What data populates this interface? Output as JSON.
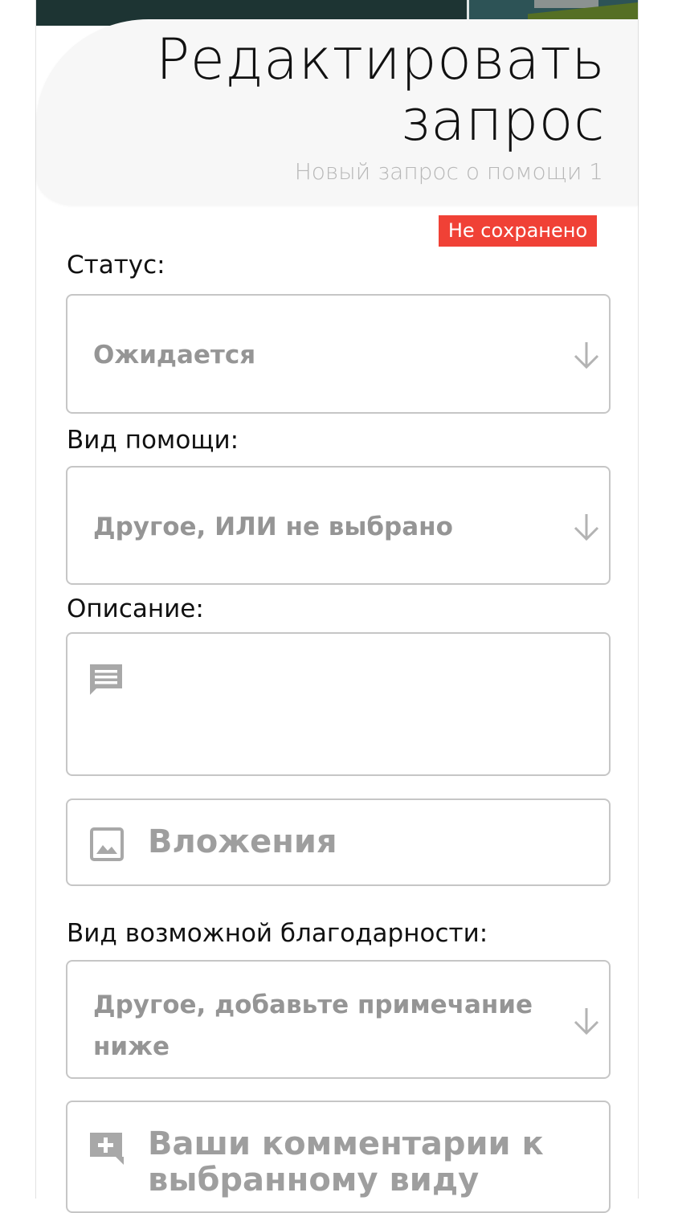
{
  "header": {
    "title": "Редактировать запрос",
    "subtitle": "Новый запрос о помощи 1",
    "status_badge": "Не сохранено"
  },
  "form": {
    "status": {
      "label": "Статус:",
      "value": "Ожидается"
    },
    "help_type": {
      "label": "Вид помощи:",
      "value": "Другое, ИЛИ не выбрано"
    },
    "description": {
      "label": "Описание:",
      "value": ""
    },
    "attachments": {
      "placeholder": "Вложения"
    },
    "gratitude_type": {
      "label": "Вид возможной благодарности:",
      "value": "Другое, добавьте примечание ниже"
    },
    "gratitude_comment": {
      "placeholder": "Ваши комментарии к выбранному виду"
    }
  },
  "icons": {
    "select_arrow": "arrow-down-icon",
    "description": "comment-icon",
    "attachments": "image-icon",
    "comment_add": "add-comment-icon"
  },
  "colors": {
    "badge_bg": "#f04136",
    "badge_text": "#ffffff",
    "header_card_bg": "#f7f7f7",
    "hero_dark": "#1d3433",
    "hero_teal": "#2d5356",
    "hero_olive": "#556f24",
    "field_border": "#c6c6c6",
    "placeholder_text": "#959595"
  }
}
